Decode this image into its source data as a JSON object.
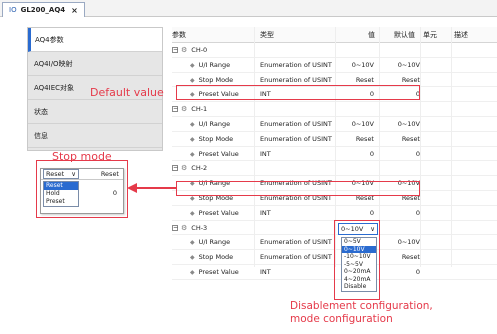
{
  "tab": {
    "prefix": "IO",
    "name": "GL200_AQ4",
    "close": "×"
  },
  "sidebar": {
    "items": [
      {
        "label": "AQ4参数",
        "active": true
      },
      {
        "label": "AQ4I/O映射",
        "active": false
      },
      {
        "label": "AQ4IEC对象",
        "active": false
      },
      {
        "label": "状态",
        "active": false
      },
      {
        "label": "信息",
        "active": false
      }
    ]
  },
  "grid": {
    "headers": {
      "param": "参数",
      "type": "类型",
      "value": "值",
      "default": "默认值",
      "unit": "单元",
      "desc": "描述"
    },
    "rows": [
      {
        "kind": "channel",
        "name": "CH-0"
      },
      {
        "kind": "param",
        "name": "U/I Range",
        "type": "Enumeration of USINT",
        "value": "0~10V",
        "default": "0~10V"
      },
      {
        "kind": "param",
        "name": "Stop Mode",
        "type": "Enumeration of USINT",
        "value": "Reset",
        "default": "Reset"
      },
      {
        "kind": "param",
        "name": "Preset Value",
        "type": "INT",
        "value": "0",
        "default": "0"
      },
      {
        "kind": "channel",
        "name": "CH-1"
      },
      {
        "kind": "param",
        "name": "U/I Range",
        "type": "Enumeration of USINT",
        "value": "0~10V",
        "default": "0~10V"
      },
      {
        "kind": "param",
        "name": "Stop Mode",
        "type": "Enumeration of USINT",
        "value": "Reset",
        "default": "Reset"
      },
      {
        "kind": "param",
        "name": "Preset Value",
        "type": "INT",
        "value": "0",
        "default": "0"
      },
      {
        "kind": "channel",
        "name": "CH-2"
      },
      {
        "kind": "param",
        "name": "U/I Range",
        "type": "Enumeration of USINT",
        "value": "0~10V",
        "default": "0~10V"
      },
      {
        "kind": "param",
        "name": "Stop Mode",
        "type": "Enumeration of USINT",
        "value": "Reset",
        "default": "Reset"
      },
      {
        "kind": "param",
        "name": "Preset Value",
        "type": "INT",
        "value": "0",
        "default": "0"
      },
      {
        "kind": "channel",
        "name": "CH-3"
      },
      {
        "kind": "param",
        "name": "U/I Range",
        "type": "Enumeration of USINT",
        "value": "",
        "default": "0~10V"
      },
      {
        "kind": "param",
        "name": "Stop Mode",
        "type": "Enumeration of USINT",
        "value": "",
        "default": "Reset"
      },
      {
        "kind": "param",
        "name": "Preset Value",
        "type": "INT",
        "value": "",
        "default": "0"
      }
    ]
  },
  "range_dropdown": {
    "selected": "0~10V",
    "arrow": "∨",
    "options": [
      "0~5V",
      "0~10V",
      "-10~10V",
      "-5~5V",
      "0~20mA",
      "4~20mA",
      "Disable"
    ],
    "highlighted": "0~10V"
  },
  "stop_popup": {
    "selected": "Reset",
    "arrow": "∨",
    "value": "Reset",
    "zero": "0",
    "options": [
      "Reset",
      "Hold",
      "Preset"
    ],
    "highlighted": "Reset"
  },
  "annotations": {
    "default_value": "Default value",
    "stop_mode": "Stop mode",
    "disable_line1": "Disablement configuration,",
    "disable_line2": "mode configuration",
    "color": "#e53a4a"
  },
  "icons": {
    "collapse": "⊟",
    "channel": "gear-icon",
    "param": "param-gear-icon"
  }
}
